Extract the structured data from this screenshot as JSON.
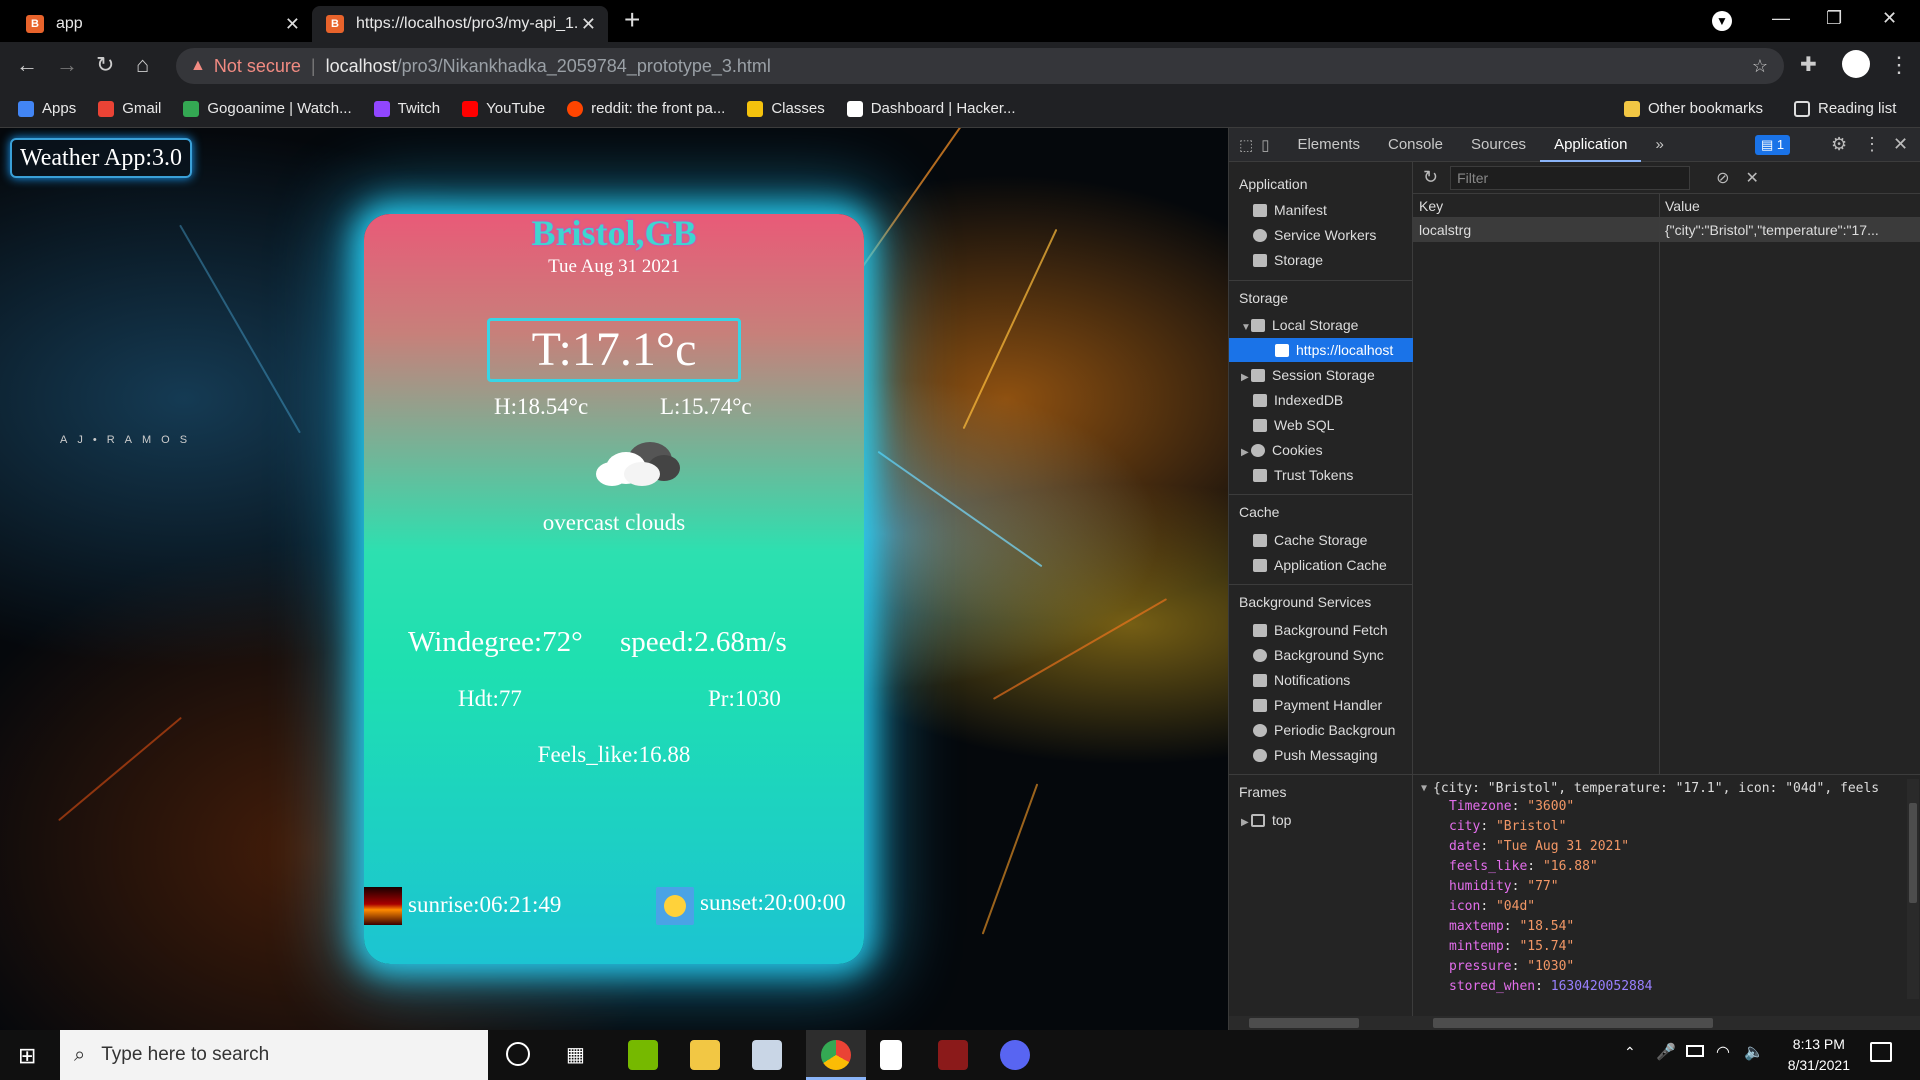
{
  "browser": {
    "tabs": [
      {
        "title": "app",
        "active": false
      },
      {
        "title": "https://localhost/pro3/my-api_1.",
        "active": true
      }
    ],
    "new_tab": "+",
    "security_label": "Not secure",
    "url_host": "localhost",
    "url_path": "/pro3/Nikankhadka_2059784_prototype_3.html",
    "bookmarks": [
      {
        "label": "Apps",
        "color": "#4285f4"
      },
      {
        "label": "Gmail",
        "color": "#ea4335"
      },
      {
        "label": "Gogoanime | Watch...",
        "color": "#34a853"
      },
      {
        "label": "Twitch",
        "color": "#9146ff"
      },
      {
        "label": "YouTube",
        "color": "#ff0000"
      },
      {
        "label": "reddit: the front pa...",
        "color": "#ff4500"
      },
      {
        "label": "Classes",
        "color": "#1e8e3e"
      },
      {
        "label": "Dashboard | Hacker...",
        "color": "#ffffff"
      }
    ],
    "other_bookmarks": "Other bookmarks",
    "reading_list": "Reading list"
  },
  "page": {
    "app_title": "Weather App:3.0",
    "watermark": "AJ•RAMOS",
    "city": "Bristol,GB",
    "date": "Tue Aug 31 2021",
    "temperature": "T:17.1°c",
    "high": "H:18.54°c",
    "low": "L:15.74°c",
    "description": "overcast clouds",
    "wind_degree": "Windegree:72°",
    "wind_speed": "speed:2.68m/s",
    "humidity": "Hdt:77",
    "pressure": "Pr:1030",
    "feels_like": "Feels_like:16.88",
    "sunrise": "sunrise:06:21:49",
    "sunset": "sunset:20:00:00"
  },
  "devtools": {
    "tabs": [
      "Elements",
      "Console",
      "Sources",
      "Application"
    ],
    "active_tab": "Application",
    "more": "»",
    "issues_count": "1",
    "sidebar": {
      "application": {
        "title": "Application",
        "items": [
          "Manifest",
          "Service Workers",
          "Storage"
        ]
      },
      "storage": {
        "title": "Storage",
        "items": [
          "Local Storage",
          "https://localhost",
          "Session Storage",
          "IndexedDB",
          "Web SQL",
          "Cookies",
          "Trust Tokens"
        ]
      },
      "cache": {
        "title": "Cache",
        "items": [
          "Cache Storage",
          "Application Cache"
        ]
      },
      "background": {
        "title": "Background Services",
        "items": [
          "Background Fetch",
          "Background Sync",
          "Notifications",
          "Payment Handler",
          "Periodic Backgroun",
          "Push Messaging"
        ]
      },
      "frames": {
        "title": "Frames",
        "items": [
          "top"
        ]
      }
    },
    "filter_placeholder": "Filter",
    "columns": {
      "key": "Key",
      "value": "Value"
    },
    "row": {
      "key": "localstrg",
      "value": "{\"city\":\"Bristol\",\"temperature\":\"17..."
    },
    "preview": {
      "summary": "{city: \"Bristol\", temperature: \"17.1\", icon: \"04d\", feels",
      "fields": [
        {
          "key": "Timezone",
          "value": "\"3600\"",
          "type": "str"
        },
        {
          "key": "city",
          "value": "\"Bristol\"",
          "type": "str"
        },
        {
          "key": "date",
          "value": "\"Tue Aug 31 2021\"",
          "type": "str"
        },
        {
          "key": "feels_like",
          "value": "\"16.88\"",
          "type": "str"
        },
        {
          "key": "humidity",
          "value": "\"77\"",
          "type": "str"
        },
        {
          "key": "icon",
          "value": "\"04d\"",
          "type": "str"
        },
        {
          "key": "maxtemp",
          "value": "\"18.54\"",
          "type": "str"
        },
        {
          "key": "mintemp",
          "value": "\"15.74\"",
          "type": "str"
        },
        {
          "key": "pressure",
          "value": "\"1030\"",
          "type": "str"
        },
        {
          "key": "stored_when",
          "value": "1630420052884",
          "type": "num"
        }
      ]
    }
  },
  "taskbar": {
    "search_placeholder": "Type here to search",
    "time": "8:13 PM",
    "date": "8/31/2021"
  }
}
